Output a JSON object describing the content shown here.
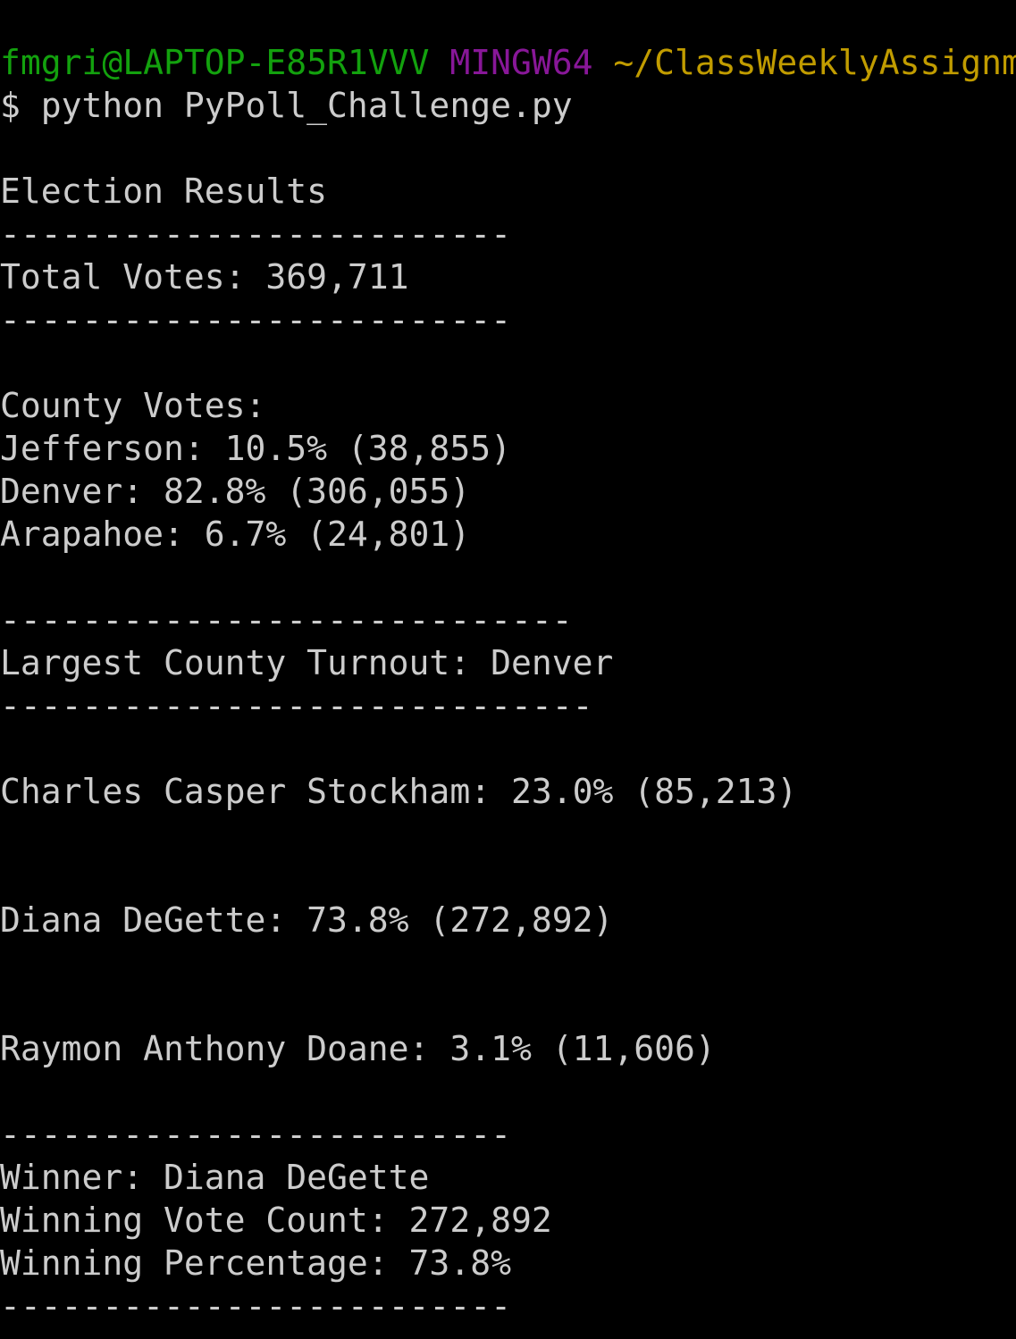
{
  "terminal": {
    "prompt": {
      "user_host": "fmgri@LAPTOP-E85R1VVV",
      "environment": "MINGW64",
      "path": "~/ClassWeeklyAssignm",
      "colors": {
        "user_host": "#13a10e",
        "environment": "#881798",
        "path": "#c19c00",
        "text": "#cccccc",
        "background": "#000000"
      }
    },
    "command": "$ python PyPoll_Challenge.py",
    "output": {
      "heading": "Election Results",
      "divider_1": "-------------------------",
      "total_votes": "Total Votes: 369,711",
      "divider_2": "-------------------------",
      "county_heading": "County Votes:",
      "county_lines": [
        "Jefferson: 10.5% (38,855)",
        "Denver: 82.8% (306,055)",
        "Arapahoe: 6.7% (24,801)"
      ],
      "divider_3": "----------------------------",
      "largest_county": "Largest County Turnout: Denver",
      "divider_4": "-----------------------------",
      "candidate_lines": [
        "Charles Casper Stockham: 23.0% (85,213)",
        "Diana DeGette: 73.8% (272,892)",
        "Raymon Anthony Doane: 3.1% (11,606)"
      ],
      "divider_5": "-------------------------",
      "winner": "Winner: Diana DeGette",
      "winning_vote_count": "Winning Vote Count: 272,892",
      "winning_percentage": "Winning Percentage: 73.8%",
      "divider_6": "-------------------------"
    }
  }
}
